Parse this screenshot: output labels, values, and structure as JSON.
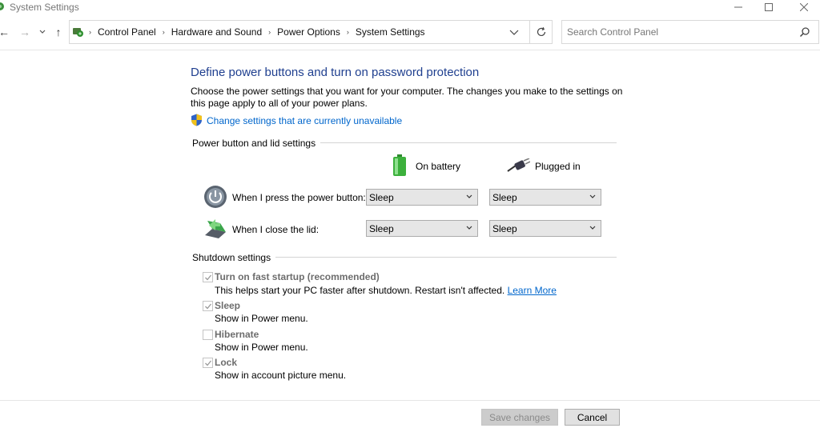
{
  "window": {
    "title": "System Settings",
    "controls": {
      "minimize": "—",
      "maximize": "☐",
      "close": "✕"
    }
  },
  "nav": {
    "back": "←",
    "forward": "→",
    "dropdown": "⌄",
    "up": "↑",
    "breadcrumbs": [
      "Control Panel",
      "Hardware and Sound",
      "Power Options",
      "System Settings"
    ],
    "refresh": "↻",
    "search_placeholder": "Search Control Panel"
  },
  "page": {
    "heading": "Define power buttons and turn on password protection",
    "description": "Choose the power settings that you want for your computer. The changes you make to the settings on this page apply to all of your power plans.",
    "change_link": "Change settings that are currently unavailable"
  },
  "power_section": {
    "label": "Power button and lid settings",
    "col_battery": "On battery",
    "col_plugged": "Plugged in",
    "rows": [
      {
        "label": "When I press the power button:",
        "battery": "Sleep",
        "plugged": "Sleep"
      },
      {
        "label": "When I close the lid:",
        "battery": "Sleep",
        "plugged": "Sleep"
      }
    ]
  },
  "shutdown_section": {
    "label": "Shutdown settings",
    "options": [
      {
        "title": "Turn on fast startup (recommended)",
        "desc": "This helps start your PC faster after shutdown. Restart isn't affected.",
        "link": "Learn More",
        "checked": true
      },
      {
        "title": "Sleep",
        "desc": "Show in Power menu.",
        "checked": true
      },
      {
        "title": "Hibernate",
        "desc": "Show in Power menu.",
        "checked": false
      },
      {
        "title": "Lock",
        "desc": "Show in account picture menu.",
        "checked": true
      }
    ]
  },
  "footer": {
    "save": "Save changes",
    "cancel": "Cancel"
  },
  "colors": {
    "heading": "#1f3f8f",
    "link": "#0066cc",
    "disabled_text": "#6d6d6d"
  }
}
